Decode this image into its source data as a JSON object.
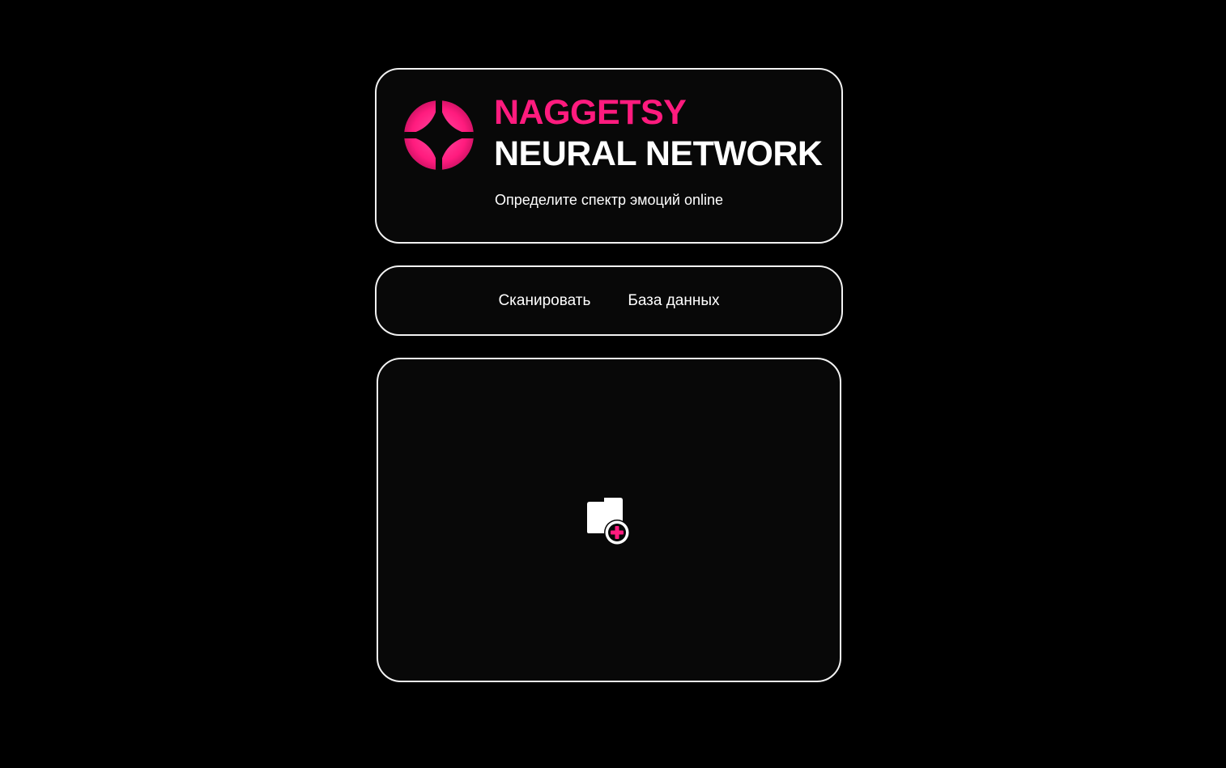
{
  "header": {
    "brand_name": "NAGGETSY",
    "brand_subtitle": "NEURAL NETWORK",
    "tagline": "Определите спектр эмоций online",
    "logo_icon": "pink-four-point-star-logo"
  },
  "nav": {
    "items": [
      {
        "label": "Сканировать"
      },
      {
        "label": "База данных"
      }
    ]
  },
  "upload": {
    "icon": "add-file-icon"
  },
  "colors": {
    "background": "#000000",
    "card_background": "#080808",
    "border": "#f2f2f2",
    "accent": "#ff1b7e",
    "text": "#ffffff"
  }
}
